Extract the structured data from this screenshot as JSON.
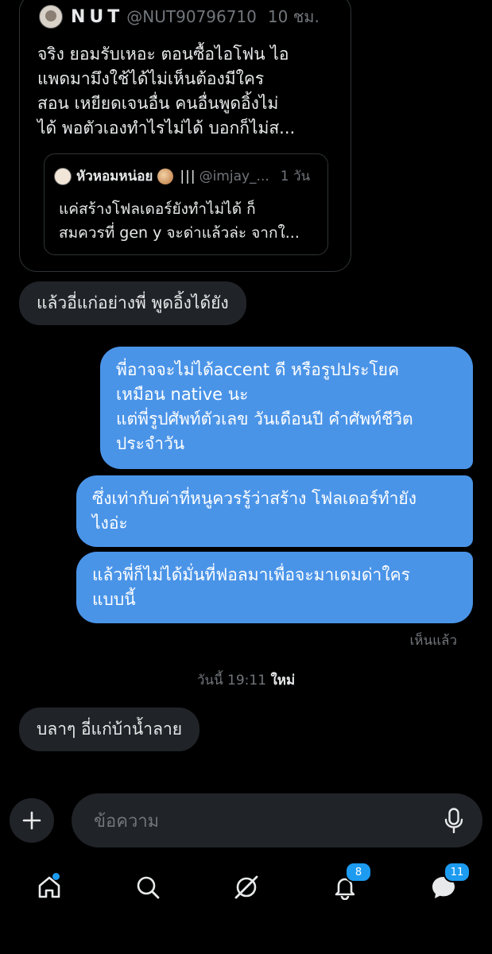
{
  "tweet": {
    "author_name": "NUT",
    "handle": "@NUT90796710",
    "time": "10 ชม.",
    "text_lines": [
      "จริง ยอมรับเหอะ ตอนซื้อไอโฟน ไอ",
      "แพดมามึงใช้ได้ไม่เห็นต้องมีใคร",
      "สอน เหยียดเจนอื่น คนอื่นพูดอิ้งไม่",
      "ได้ พอตัวเองทำไรไม่ได้ บอกก็ไม่ส..."
    ],
    "quote": {
      "author_name": "หัวหอมหน่อย",
      "bars": "|||",
      "handle": "@imjay_...",
      "time": "1 วัน",
      "text_lines": [
        "แค่สร้างโฟลเดอร์ยังทำไม่ได้ ก็",
        "สมควรที่ gen y จะด่าแล้วล่ะ จากใ..."
      ]
    }
  },
  "messages": {
    "in_1": "แล้วอี่แก่อย่างพี่ พูดอิ้งได้ยัง",
    "out_1_lines": [
      "พี่อาจจะไม่ได้accent ดี หรือรูปประโยค",
      "เหมือน native  นะ",
      "แต่พี่รูปศัพท์ตัวเลข วันเดือนปี คำศัพท์ชีวิต",
      "ประจำวัน"
    ],
    "out_2_lines": [
      "ซึ่งเท่ากับค่าที่หนูควรรู้ว่าสร้าง โฟลเดอร์ทำยัง",
      "ไงอ่ะ"
    ],
    "out_3_lines": [
      "แล้วพี่ก็ไม่ได้มั่นที่ฟอลมาเพื่อจะมาเดมด่าใคร",
      "แบบนี้"
    ],
    "seen": "เห็นแล้ว",
    "date_divider": "วันนี้ 19:11",
    "date_new": "ใหม่",
    "in_2": "บลาๆ อี่แก่บ้าน้ำลาย"
  },
  "composer": {
    "placeholder": "ข้อความ"
  },
  "tabbar": {
    "notifications_badge": "8",
    "messages_badge": "11"
  },
  "colors": {
    "outgoing_bubble": "#4a94e8",
    "incoming_bubble": "#202327",
    "accent": "#1d9bf0",
    "background": "#000000"
  },
  "icons": [
    "plus-icon",
    "microphone-icon",
    "home-icon",
    "search-icon",
    "grok-icon",
    "bell-icon",
    "envelope-icon"
  ]
}
